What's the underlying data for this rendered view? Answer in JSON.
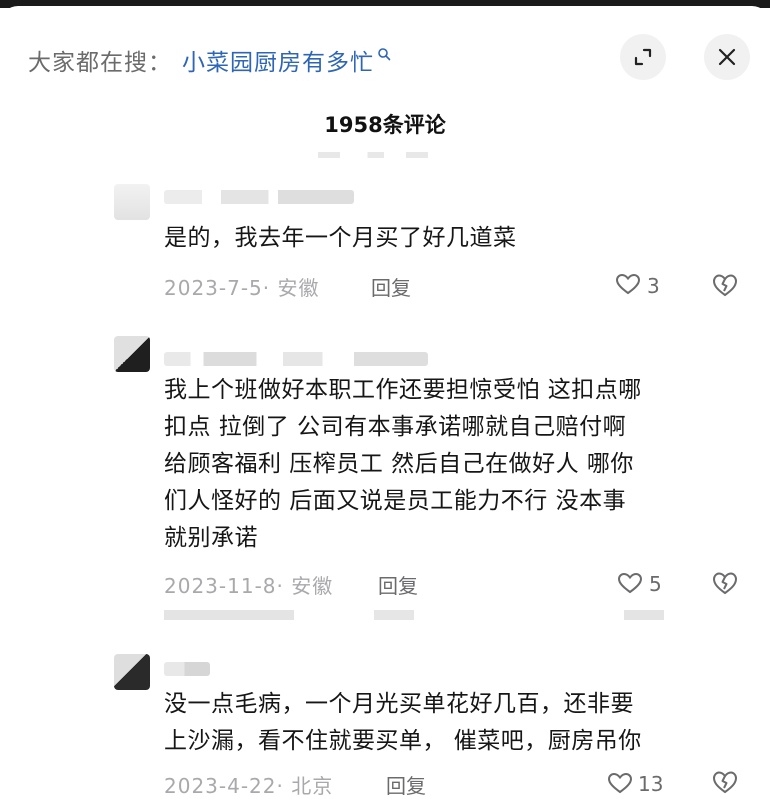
{
  "search": {
    "prefix": "大家都在搜：",
    "term": "小菜园厨房有多忙"
  },
  "header": {
    "title": "1958条评论"
  },
  "comments": [
    {
      "text": "是的，我去年一个月买了好几道菜",
      "date": "2023-7-5· 安徽",
      "reply": "回复",
      "likes": "3"
    },
    {
      "text_lines": [
        "我上个班做好本职工作还要担惊受怕 这扣点哪",
        "扣点 拉倒了 公司有本事承诺哪就自己赔付啊",
        "给顾客福利 压榨员工 然后自己在做好人 哪你",
        "们人怪好的 后面又说是员工能力不行 没本事",
        "就别承诺"
      ],
      "date": "2023-11-8· 安徽",
      "reply": "回复",
      "likes": "5"
    },
    {
      "text_lines": [
        "没一点毛病，一个月光买单花好几百，还非要",
        "上沙漏，看不住就要买单， 催菜吧，厨房吊你"
      ],
      "date": "2023-4-22· 北京",
      "reply": "回复",
      "likes": "13"
    }
  ],
  "colors": {
    "search_term": "#2e66b5",
    "muted": "#a9a9ad",
    "text": "#161616"
  }
}
